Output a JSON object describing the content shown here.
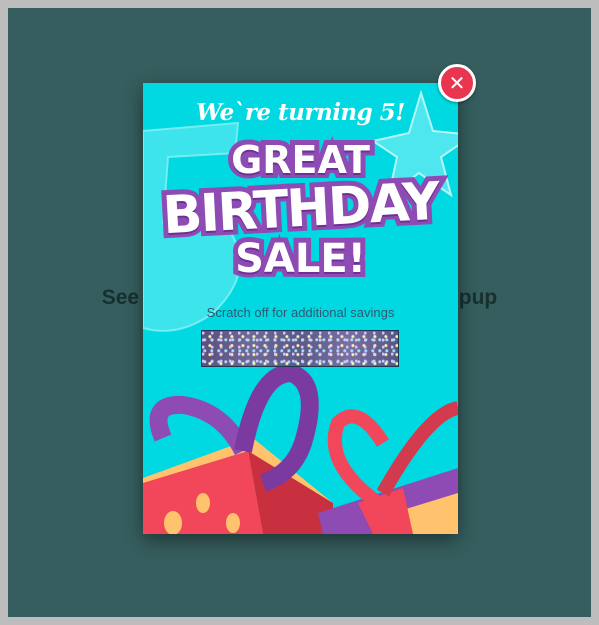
{
  "page": {
    "background_text": "See it in action! Click to view the popup"
  },
  "popup": {
    "headline": "We`re turning 5!",
    "title_line_1": "GREAT",
    "title_line_2": "BIRTHDAY",
    "title_line_3": "SALE!",
    "subtitle": "Scratch off for additional savings",
    "close_icon": "close-icon"
  },
  "colors": {
    "page_bg": "#365e5e",
    "popup_bg": "#00d9e1",
    "title_outline": "#8e4bb3",
    "close_button": "#e8364f",
    "gift_yellow": "#ffc36e",
    "gift_red": "#f2465a",
    "ribbon_purple": "#8e4bb3"
  }
}
